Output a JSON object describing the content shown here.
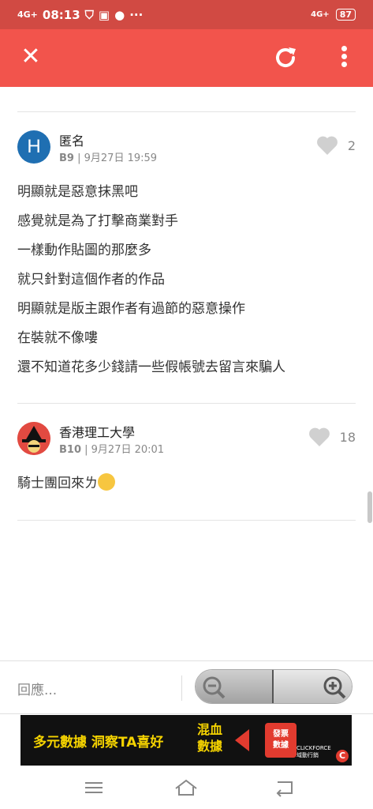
{
  "status_bar": {
    "network_left": "4G+",
    "time": "08:13",
    "network_right": "4G+",
    "battery": "87"
  },
  "app_bar": {
    "close_icon": "close-icon",
    "refresh_icon": "refresh-icon",
    "more_icon": "more-vertical-icon"
  },
  "posts": [
    {
      "avatar_letter": "H",
      "author": "匿名",
      "floor": "B9",
      "date": "9月27日 19:59",
      "likes": "2",
      "lines": [
        "明顯就是惡意抹黑吧",
        "感覺就是為了打擊商業對手",
        "一樣動作貼圖的那麼多",
        "就只針對這個作者的作品",
        "明顯就是版主跟作者有過節的惡意操作",
        "在裝就不像嘍",
        "還不知道花多少錢請一些假帳號去留言來騙人"
      ]
    },
    {
      "author": "香港理工大學",
      "floor": "B10",
      "date": "9月27日 20:01",
      "likes": "18",
      "lines": [
        "騎士團回來ㄌ"
      ]
    }
  ],
  "reply": {
    "placeholder": "回應..."
  },
  "ad": {
    "text_left": "多元數據 洞察TA喜好",
    "text_right_1": "混血",
    "text_right_2": "數據",
    "badge_1": "發票",
    "badge_2": "數據",
    "brand": "CLICKFORCE",
    "brand_sub": "域動行銷"
  },
  "colors": {
    "status_bar": "#d14a43",
    "app_bar": "#f2544c",
    "avatar_blue": "#1f6fb2"
  }
}
